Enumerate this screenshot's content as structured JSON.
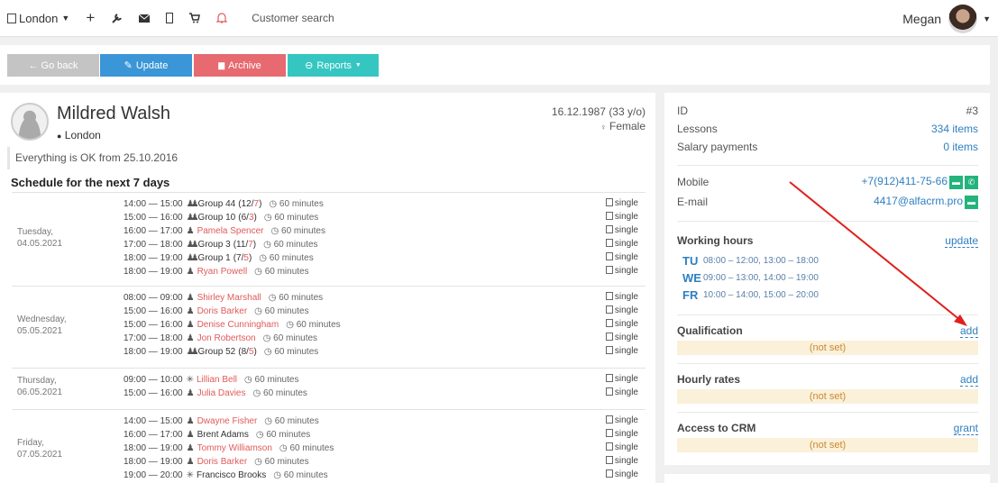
{
  "topbar": {
    "branch": "London",
    "icons": [
      "add-icon",
      "wrench-icon",
      "envelope-icon",
      "phone-icon",
      "cart-icon",
      "bell-icon"
    ],
    "search_label": "Customer search",
    "user_name": "Megan"
  },
  "actions": {
    "back": "← Go back",
    "update": "Update",
    "archive": "Archive",
    "reports": "Reports"
  },
  "colors": {
    "back": "#c4c4c4",
    "update": "#3a96d6",
    "archive": "#e66a70",
    "reports": "#35c6c2",
    "link": "#e05a5a",
    "accent": "#2e7fc0",
    "green": "#24b37c",
    "notset_bg": "#fbf0d9"
  },
  "profile": {
    "name": "Mildred Walsh",
    "city": "London",
    "dob": "16.12.1987 (33 y/o)",
    "gender": "Female",
    "note": "Everything is OK from 25.10.2016"
  },
  "schedule": {
    "title": "Schedule for the next 7 days",
    "single_label": "single",
    "days": [
      {
        "weekday": "Tuesday,",
        "date": "04.05.2021",
        "lessons": [
          {
            "time": "14:00 — 15:00",
            "icon": "group",
            "name": "Group 44",
            "count_a": "12",
            "count_b": "7",
            "duration": "60 minutes"
          },
          {
            "time": "15:00 — 16:00",
            "icon": "group",
            "name": "Group 10",
            "count_a": "6",
            "count_b": "3",
            "duration": "60 minutes"
          },
          {
            "time": "16:00 — 17:00",
            "icon": "person",
            "name": "Pamela Spencer",
            "duration": "60 minutes"
          },
          {
            "time": "17:00 — 18:00",
            "icon": "group",
            "name": "Group 3",
            "count_a": "11",
            "count_b": "7",
            "duration": "60 minutes"
          },
          {
            "time": "18:00 — 19:00",
            "icon": "group",
            "name": "Group 1",
            "count_a": "7",
            "count_b": "5",
            "duration": "60 minutes"
          },
          {
            "time": "18:00 — 19:00",
            "icon": "person",
            "name": "Ryan Powell",
            "duration": "60 minutes"
          }
        ]
      },
      {
        "weekday": "Wednesday,",
        "date": "05.05.2021",
        "lessons": [
          {
            "time": "08:00 — 09:00",
            "icon": "person",
            "name": "Shirley Marshall",
            "duration": "60 minutes"
          },
          {
            "time": "15:00 — 16:00",
            "icon": "person",
            "name": "Doris Barker",
            "duration": "60 minutes"
          },
          {
            "time": "15:00 — 16:00",
            "icon": "person",
            "name": "Denise Cunningham",
            "duration": "60 minutes"
          },
          {
            "time": "17:00 — 18:00",
            "icon": "person",
            "name": "Jon Robertson",
            "duration": "60 minutes"
          },
          {
            "time": "18:00 — 19:00",
            "icon": "group",
            "name": "Group 52",
            "count_a": "8",
            "count_b": "5",
            "duration": "60 minutes"
          }
        ]
      },
      {
        "weekday": "Thursday,",
        "date": "06.05.2021",
        "lessons": [
          {
            "time": "09:00 — 10:00",
            "icon": "trial",
            "name": "Lillian Bell",
            "duration": "60 minutes"
          },
          {
            "time": "15:00 — 16:00",
            "icon": "person",
            "name": "Julia Davies",
            "duration": "60 minutes"
          }
        ]
      },
      {
        "weekday": "Friday,",
        "date": "07.05.2021",
        "lessons": [
          {
            "time": "14:00 — 15:00",
            "icon": "person",
            "name": "Dwayne Fisher",
            "duration": "60 minutes"
          },
          {
            "time": "16:00 — 17:00",
            "icon": "person",
            "name": "Brent Adams",
            "plain": true,
            "duration": "60 minutes"
          },
          {
            "time": "18:00 — 19:00",
            "icon": "person",
            "name": "Tommy Williamson",
            "duration": "60 minutes"
          },
          {
            "time": "18:00 — 19:00",
            "icon": "person",
            "name": "Doris Barker",
            "duration": "60 minutes"
          },
          {
            "time": "19:00 — 20:00",
            "icon": "trial",
            "name": "Francisco Brooks",
            "plain": true,
            "duration": "60 minutes"
          }
        ]
      }
    ]
  },
  "side": {
    "id_label": "ID",
    "id_value": "#3",
    "lessons_label": "Lessons",
    "lessons_value": "334 items",
    "salary_label": "Salary payments",
    "salary_value": "0 items",
    "mobile_label": "Mobile",
    "mobile_value": "+7(912)411-75-66",
    "email_label": "E-mail",
    "email_value": "4417@alfacrm.pro",
    "working_hours": {
      "title": "Working hours",
      "link": "update",
      "rows": [
        {
          "day": "TU",
          "hours": "08:00 – 12:00, 13:00 – 18:00"
        },
        {
          "day": "WE",
          "hours": "09:00 – 13:00, 14:00 – 19:00"
        },
        {
          "day": "FR",
          "hours": "10:00 – 14:00, 15:00 – 20:00"
        }
      ]
    },
    "qualification": {
      "title": "Qualification",
      "link": "add",
      "value": "(not set)"
    },
    "hourly_rates": {
      "title": "Hourly rates",
      "link": "add",
      "value": "(not set)"
    },
    "access": {
      "title": "Access to CRM",
      "link": "grant",
      "value": "(not set)"
    }
  }
}
